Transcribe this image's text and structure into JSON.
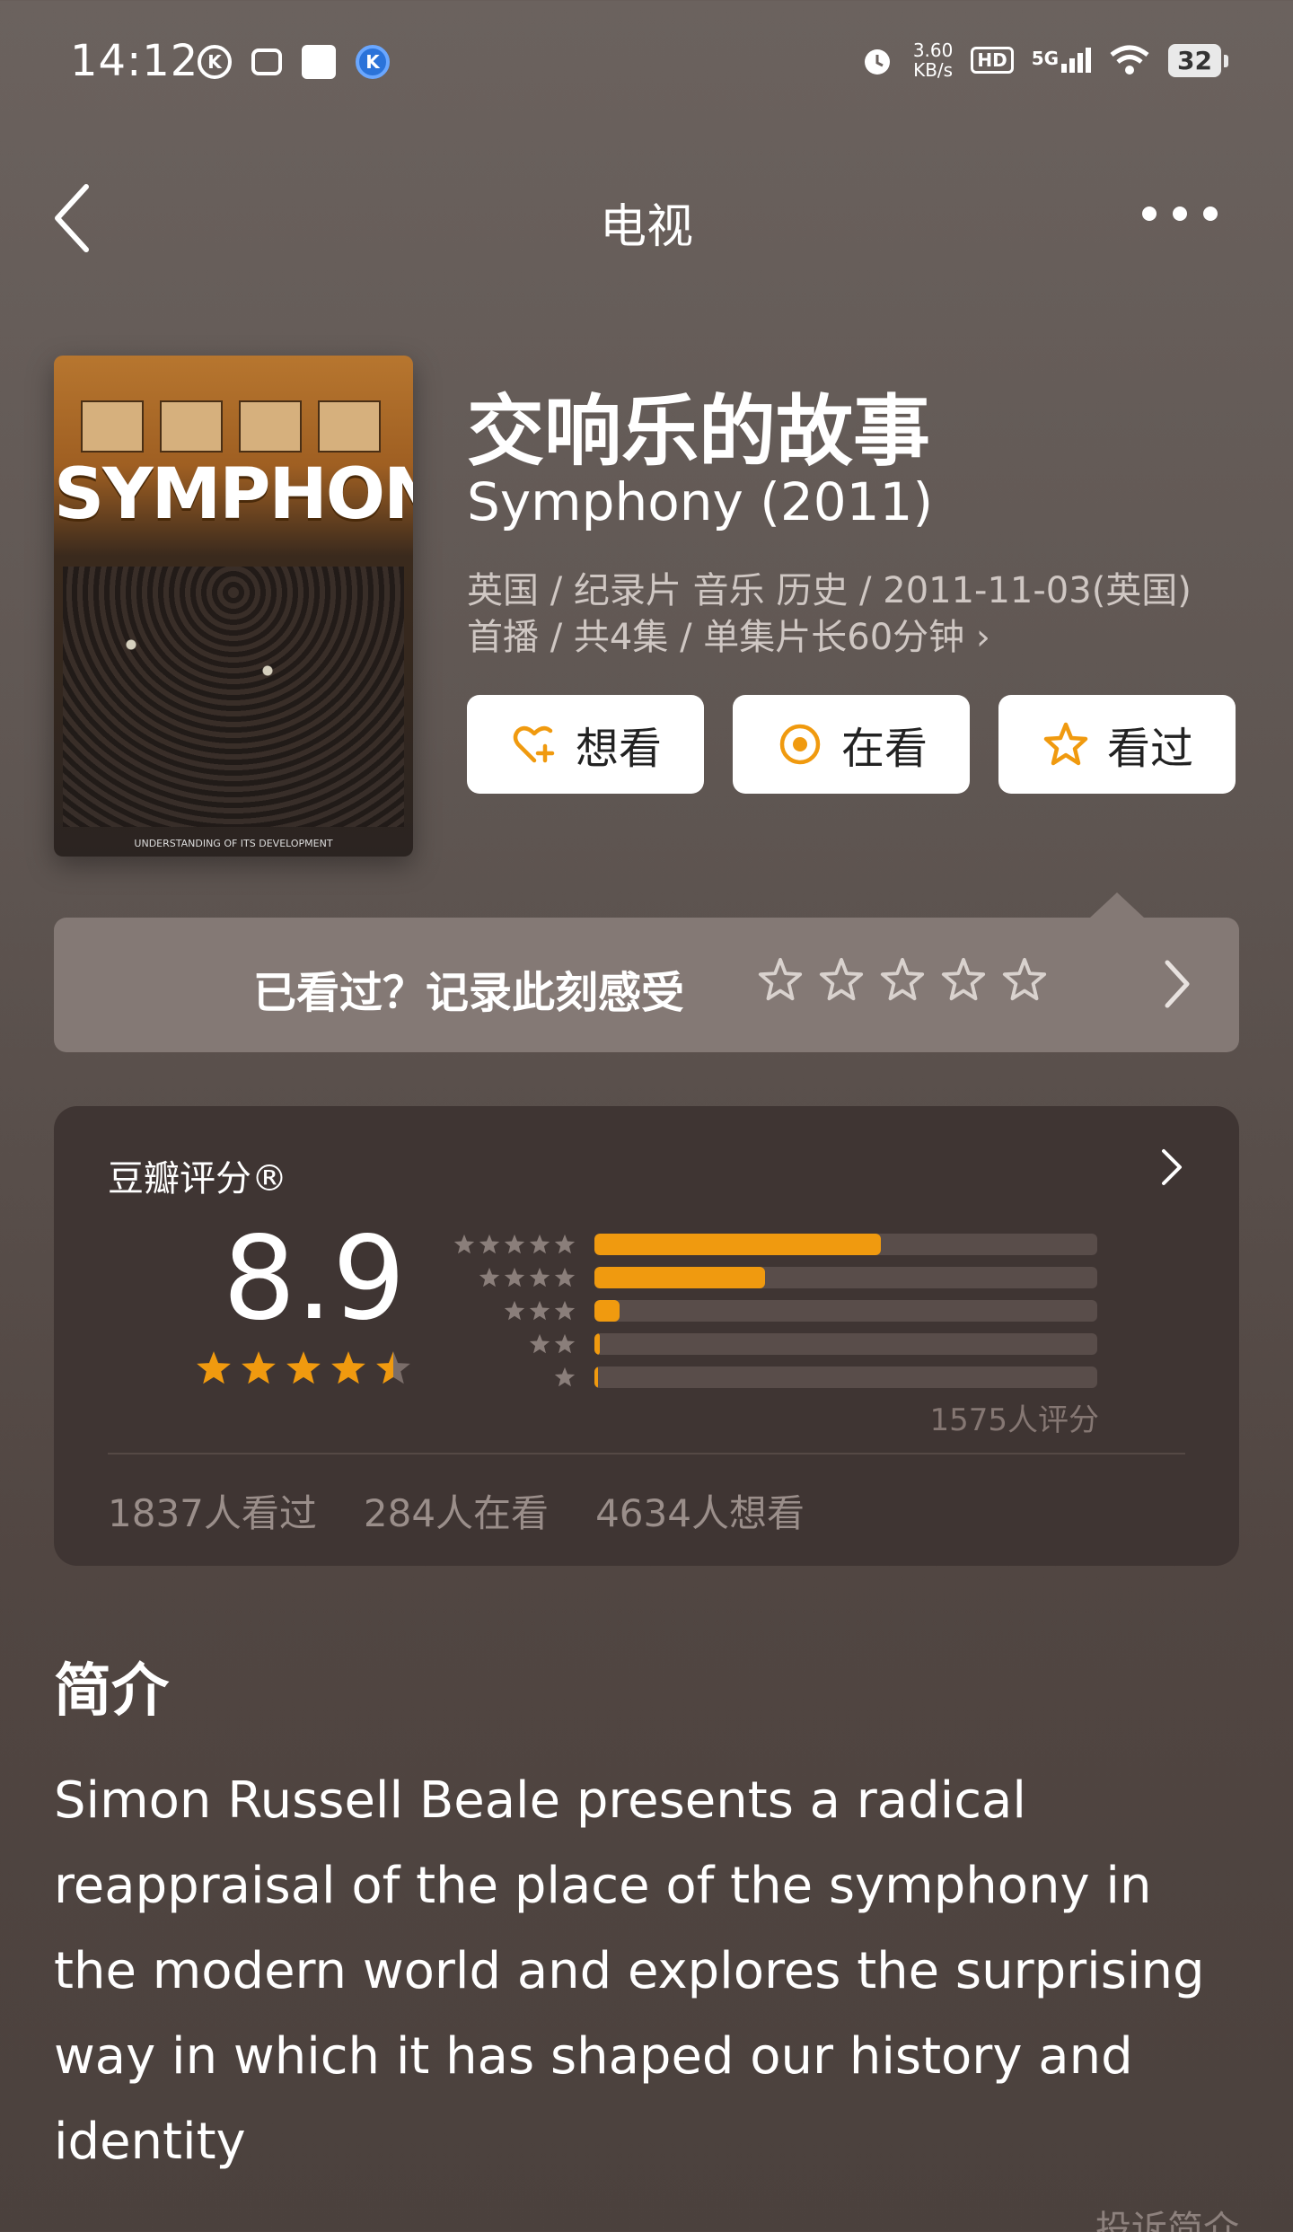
{
  "status_bar": {
    "time": "14:12",
    "left_icons": [
      "k-icon",
      "tv-icon",
      "square-icon",
      "k-blue-icon"
    ],
    "speed_value": "3.60",
    "speed_unit": "KB/s",
    "hd": "HD",
    "network": "5G",
    "battery": "32"
  },
  "header": {
    "title": "电视"
  },
  "movie": {
    "title_cn": "交响乐的故事",
    "title_en": "Symphony (2011)",
    "meta": "英国 / 纪录片 音乐 历史 / 2011-11-03(英国)首播 / 共4集 / 单集片长60分钟",
    "meta_chevron": "›",
    "poster": {
      "title": "SYMPHONY",
      "footer": "UNDERSTANDING OF ITS DEVELOPMENT"
    }
  },
  "actions": {
    "want": "想看",
    "watching": "在看",
    "watched": "看过"
  },
  "record": {
    "prompt": "已看过？记录此刻感受"
  },
  "rating": {
    "label": "豆瓣评分",
    "reg_mark": "®",
    "score": "8.9",
    "stars_value": 4.5,
    "distribution": [
      {
        "stars": 5,
        "fraction": 0.57
      },
      {
        "stars": 4,
        "fraction": 0.34
      },
      {
        "stars": 3,
        "fraction": 0.05
      },
      {
        "stars": 2,
        "fraction": 0.01
      },
      {
        "stars": 1,
        "fraction": 0.005
      }
    ],
    "count_text": "1575人评分",
    "stats": {
      "watched": "1837人看过",
      "watching": "284人在看",
      "want": "4634人想看"
    }
  },
  "synopsis": {
    "title": "简介",
    "text": "Simon Russell Beale presents a radical reappraisal of the place of the symphony in the modern world and explores the surprising way in which it has shaped our history and identity",
    "report": "投诉简介"
  },
  "colors": {
    "accent": "#f09a0f",
    "card_bg": "#3f3533",
    "record_bg": "#847975"
  }
}
